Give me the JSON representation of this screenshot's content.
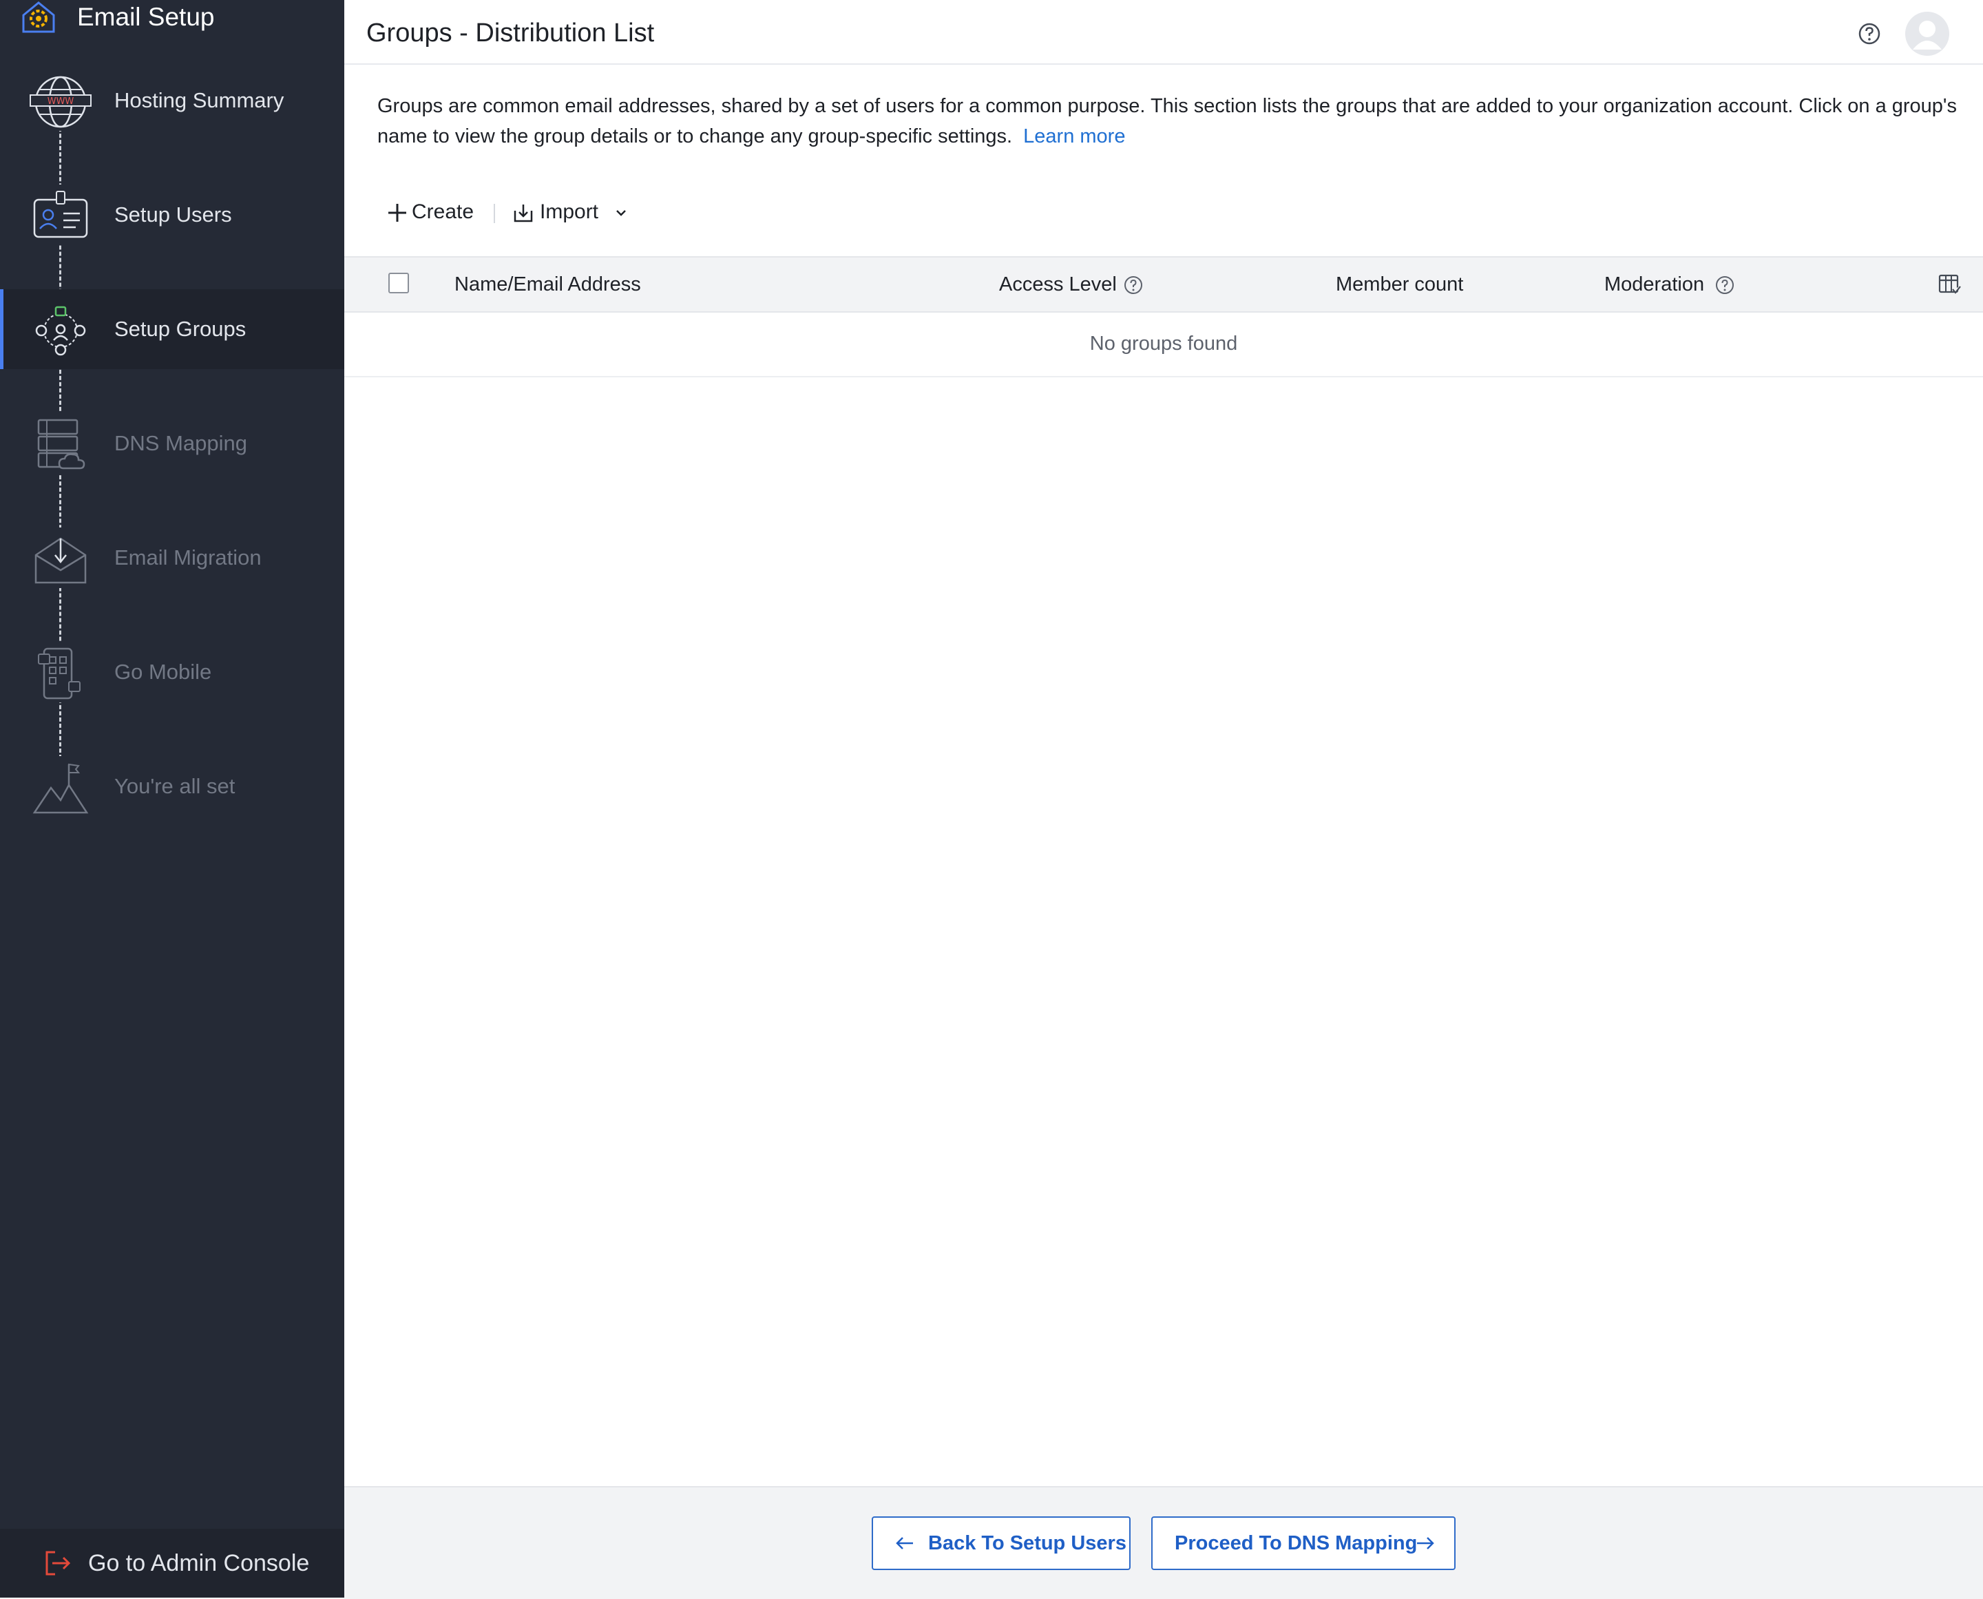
{
  "app": {
    "title": "Email Setup"
  },
  "sidebar": {
    "steps": [
      {
        "label": "Hosting Summary",
        "state": "done",
        "icon": "globe-www-icon"
      },
      {
        "label": "Setup Users",
        "state": "done",
        "icon": "user-id-card-icon"
      },
      {
        "label": "Setup Groups",
        "state": "active",
        "icon": "group-network-icon"
      },
      {
        "label": "DNS Mapping",
        "state": "todo",
        "icon": "server-cloud-icon"
      },
      {
        "label": "Email Migration",
        "state": "todo",
        "icon": "envelope-download-icon"
      },
      {
        "label": "Go Mobile",
        "state": "todo",
        "icon": "mobile-apps-icon"
      },
      {
        "label": "You're all set",
        "state": "todo",
        "icon": "mountain-flag-icon"
      }
    ],
    "admin_console_label": "Go to Admin Console"
  },
  "header": {
    "title": "Groups - Distribution List"
  },
  "description": {
    "text": "Groups are common email addresses, shared by a set of users for a common purpose. This section lists the groups that are added to your organization account. Click on a group's name to view the group details or to change any group-specific settings.",
    "link": "Learn more"
  },
  "toolbar": {
    "create_label": "Create",
    "import_label": "Import"
  },
  "table": {
    "columns": [
      "Name/Email Address",
      "Access Level",
      "Member count",
      "Moderation"
    ],
    "rows": [],
    "empty_text": "No groups found"
  },
  "footer": {
    "back_label": "Back To Setup Users",
    "proceed_label": "Proceed To DNS Mapping"
  },
  "colors": {
    "sidebar_bg": "#252a36",
    "accent": "#4a7ff0",
    "link": "#1f6fd2",
    "button_text": "#1f5fc6"
  }
}
